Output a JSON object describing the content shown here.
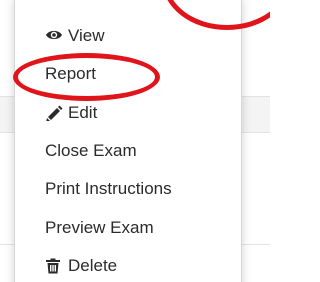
{
  "menu": {
    "items": [
      {
        "label": "View",
        "icon": "eye-icon"
      },
      {
        "label": "Report",
        "icon": ""
      },
      {
        "label": "Edit",
        "icon": "pencil-icon"
      },
      {
        "label": "Close Exam",
        "icon": ""
      },
      {
        "label": "Print Instructions",
        "icon": ""
      },
      {
        "label": "Preview Exam",
        "icon": ""
      },
      {
        "label": "Delete",
        "icon": "trash-icon"
      }
    ]
  },
  "colors": {
    "annotation": "#e0141b",
    "text": "#2b2b2b"
  }
}
